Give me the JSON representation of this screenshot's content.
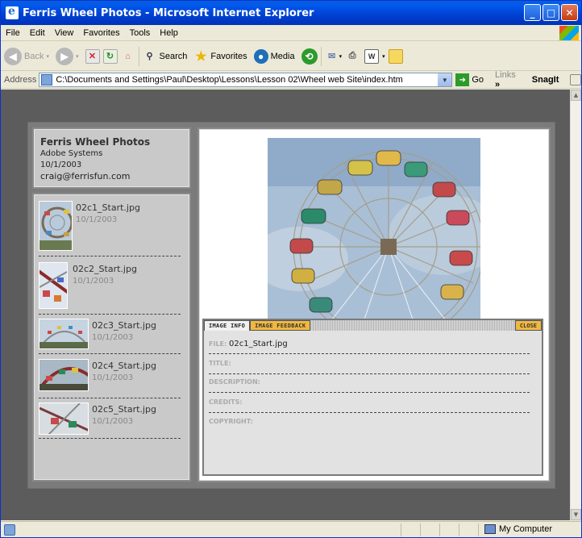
{
  "window": {
    "title": "Ferris Wheel Photos - Microsoft Internet Explorer"
  },
  "menu": [
    "File",
    "Edit",
    "View",
    "Favorites",
    "Tools",
    "Help"
  ],
  "toolbar": {
    "back": "Back",
    "search": "Search",
    "favorites": "Favorites",
    "media": "Media"
  },
  "address": {
    "label": "Address",
    "value": "C:\\Documents and Settings\\Paul\\Desktop\\Lessons\\Lesson 02\\Wheel web Site\\index.htm",
    "go": "Go",
    "links": "Links",
    "chevron": "»",
    "snagit": "SnagIt"
  },
  "gallery": {
    "title": "Ferris Wheel Photos",
    "company": "Adobe Systems",
    "date": "10/1/2003",
    "email": "craig@ferrisfun.com",
    "thumbnails": [
      {
        "name": "02c1_Start.jpg",
        "date": "10/1/2003"
      },
      {
        "name": "02c2_Start.jpg",
        "date": "10/1/2003"
      },
      {
        "name": "02c3_Start.jpg",
        "date": "10/1/2003"
      },
      {
        "name": "02c4_Start.jpg",
        "date": "10/1/2003"
      },
      {
        "name": "02c5_Start.jpg",
        "date": "10/1/2003"
      }
    ]
  },
  "info": {
    "tab_info": "IMAGE INFO",
    "tab_feedback": "IMAGE FEEDBACK",
    "close": "CLOSE",
    "file_label": "FILE:",
    "file_value": "02c1_Start.jpg",
    "title_label": "TITLE:",
    "description_label": "DESCRIPTION:",
    "credits_label": "CREDITS:",
    "copyright_label": "COPYRIGHT:"
  },
  "status": {
    "zone": "My Computer"
  },
  "icons": [
    "ie-icon",
    "minimize-icon",
    "maximize-icon",
    "close-icon",
    "back-icon",
    "forward-icon",
    "stop-icon",
    "refresh-icon",
    "home-icon",
    "search-icon",
    "favorites-icon",
    "media-icon",
    "history-icon",
    "mail-icon",
    "print-icon",
    "edit-icon",
    "folder-icon",
    "page-icon",
    "go-icon",
    "computer-icon"
  ]
}
